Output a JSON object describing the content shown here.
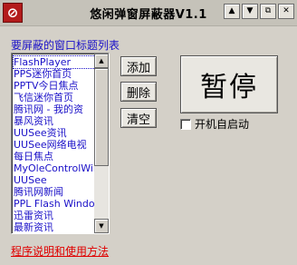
{
  "window": {
    "title": "悠闲弹窗屏蔽器V1.1",
    "app_icon_glyph": "⊘",
    "controls": {
      "up": "▲",
      "down": "▼",
      "restore": "⧉",
      "close": "✕"
    }
  },
  "list": {
    "label": "要屏蔽的窗口标题列表",
    "items": [
      "FlashPlayer",
      "PPS迷你首页",
      "PPTV今日焦点",
      "飞信迷你首页",
      "腾讯网 - 我的资",
      "暴风资讯",
      "UUSee资讯",
      "UUSee网络电视",
      "每日焦点",
      "MyOleControlWin",
      "UUSee",
      "腾讯网新闻",
      "PPL Flash Windo",
      "迅雷资讯",
      "最新资讯"
    ],
    "selected_index": 0
  },
  "buttons": {
    "add": "添加",
    "delete": "删除",
    "clear": "清空",
    "pause": "暂停"
  },
  "autostart": {
    "label": "开机自启动",
    "checked": false
  },
  "help_link": "程序说明和使用方法",
  "colors": {
    "text_blue": "#1a10c8",
    "link_red": "#e00000",
    "face": "#d4d0c8"
  }
}
